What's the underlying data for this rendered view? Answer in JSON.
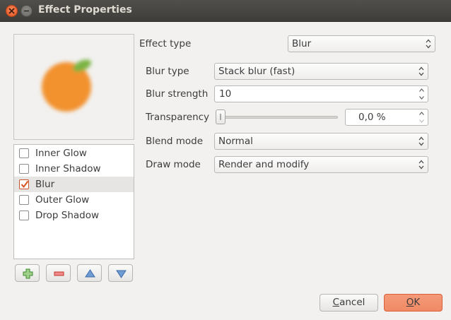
{
  "window": {
    "title": "Effect Properties"
  },
  "effects": [
    {
      "label": "Inner Glow",
      "checked": false,
      "selected": false
    },
    {
      "label": "Inner Shadow",
      "checked": false,
      "selected": false
    },
    {
      "label": "Blur",
      "checked": true,
      "selected": true
    },
    {
      "label": "Outer Glow",
      "checked": false,
      "selected": false
    },
    {
      "label": "Drop Shadow",
      "checked": false,
      "selected": false
    }
  ],
  "form": {
    "effect_type_label": "Effect type",
    "effect_type_value": "Blur",
    "blur_type_label": "Blur type",
    "blur_type_value": "Stack blur (fast)",
    "blur_strength_label": "Blur strength",
    "blur_strength_value": "10",
    "transparency_label": "Transparency",
    "transparency_value": "0,0 %",
    "transparency_level": 0,
    "blend_mode_label": "Blend mode",
    "blend_mode_value": "Normal",
    "draw_mode_label": "Draw mode",
    "draw_mode_value": "Render and modify"
  },
  "buttons": {
    "cancel_mnemonic": "C",
    "cancel_rest": "ancel",
    "ok_mnemonic": "O",
    "ok_rest": "K"
  },
  "colors": {
    "accent": "#f08a64",
    "preview_fruit": "#f2922e",
    "preview_leaf": "#7cb342"
  }
}
